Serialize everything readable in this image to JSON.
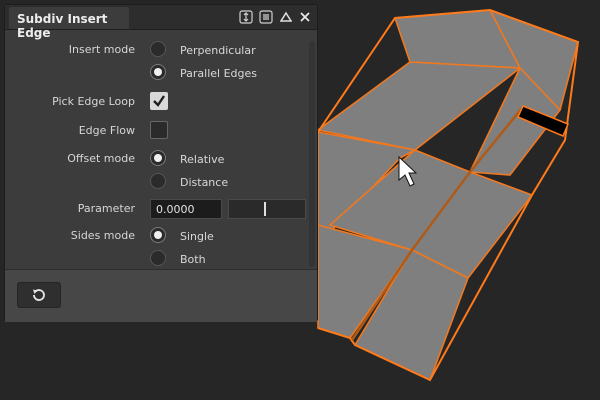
{
  "panel": {
    "title": "Subdiv Insert Edge"
  },
  "icons": {
    "dock": "dock-toggle-icon",
    "menu": "hamburger-menu-icon",
    "collapse": "collapse-triangle-icon",
    "close": "close-icon",
    "reset": "reset-undo-icon",
    "cursor": "mouse-cursor-icon"
  },
  "insert_mode": {
    "label": "Insert mode",
    "options": [
      "Perpendicular",
      "Parallel Edges"
    ],
    "selected": "Parallel Edges"
  },
  "pick_edge_loop": {
    "label": "Pick Edge Loop",
    "checked": true
  },
  "edge_flow": {
    "label": "Edge Flow",
    "checked": false
  },
  "offset_mode": {
    "label": "Offset mode",
    "options": [
      "Relative",
      "Distance"
    ],
    "selected": "Relative"
  },
  "parameter": {
    "label": "Parameter",
    "value": "0.0000",
    "slider_fraction": 0.47
  },
  "sides_mode": {
    "label": "Sides mode",
    "options": [
      "Single",
      "Both"
    ],
    "selected": "Single"
  },
  "colors": {
    "mesh_face": "#7d7d7d",
    "mesh_edge": "#ff7a1a",
    "background": "#262626",
    "panel": "#3c3c3c"
  }
}
